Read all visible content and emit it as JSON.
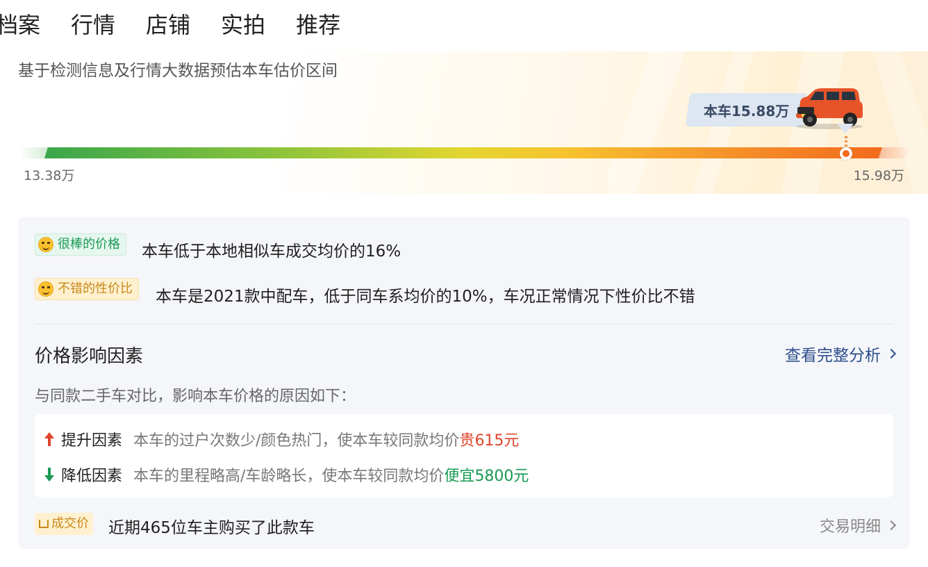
{
  "tabs": [
    {
      "label": "档案",
      "active": false
    },
    {
      "label": "行情",
      "active": true
    },
    {
      "label": "店铺",
      "active": false
    },
    {
      "label": "实拍",
      "active": false
    },
    {
      "label": "推荐",
      "active": false
    }
  ],
  "hero": {
    "subtitle": "基于检测信息及行情大数据预估本车估价区间",
    "current_price_label": "本车15.88万",
    "range_min": "13.38万",
    "range_max": "15.98万",
    "car_color": "#e8542a"
  },
  "summary": {
    "tag1": {
      "label": "很棒的价格",
      "icon": "grin-emoji-icon",
      "text": "本车低于本地相似车成交均价的16%"
    },
    "tag2": {
      "label": "不错的性价比",
      "icon": "smile-emoji-icon",
      "text": "本车是2021款中配车，低于同车系均价的10%，车况正常情况下性价比不错"
    }
  },
  "factors": {
    "title": "价格影响因素",
    "link": "查看完整分析",
    "description": "与同款二手车对比，影响本车价格的原因如下：",
    "up": {
      "label": "提升因素",
      "text": "本车的过户次数少/颜色热门，使本车较同款均价",
      "value": "贵615元"
    },
    "down": {
      "label": "降低因素",
      "text": "本车的里程略高/车龄略长，使本车较同款均价",
      "value": "便宜5800元"
    }
  },
  "deal": {
    "tag": "成交价",
    "text": "近期465位车主购买了此款车",
    "link": "交易明细"
  },
  "colors": {
    "accent_green": "#1a9a54",
    "accent_red": "#e0432b",
    "link_blue": "#2e4e8c",
    "bar_start": "#3aa64c",
    "bar_end": "#f26a1c"
  }
}
